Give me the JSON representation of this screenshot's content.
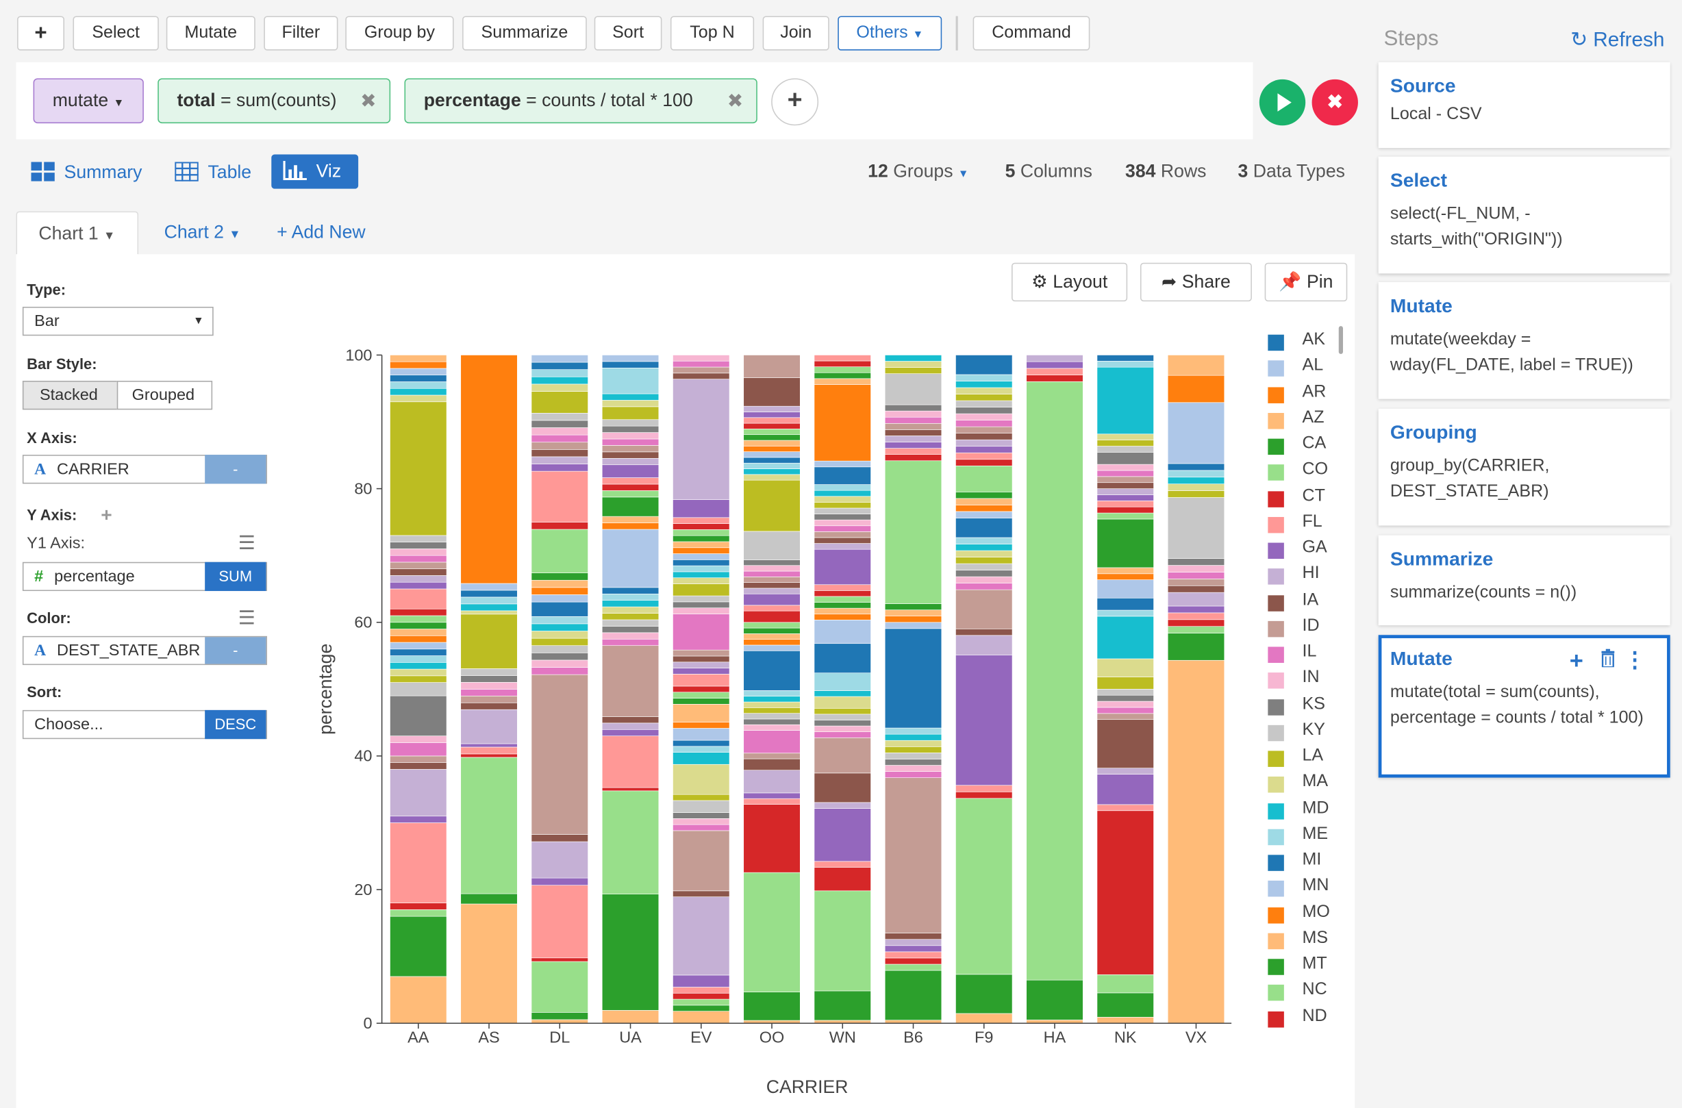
{
  "toolbar": {
    "add": "+",
    "items": [
      "Select",
      "Mutate",
      "Filter",
      "Group by",
      "Summarize",
      "Sort",
      "Top N",
      "Join"
    ],
    "others": "Others",
    "command": "Command"
  },
  "command": {
    "verb": "mutate",
    "exprs": [
      {
        "name": "total",
        "rest": " = sum(counts)"
      },
      {
        "name": "percentage",
        "rest": " = counts / total * 100"
      }
    ]
  },
  "views": {
    "summary": "Summary",
    "table": "Table",
    "viz": "Viz"
  },
  "stats": {
    "groups_n": "12",
    "groups_lbl": "Groups",
    "cols_n": "5",
    "cols_lbl": "Columns",
    "rows_n": "384",
    "rows_lbl": "Rows",
    "types_n": "3",
    "types_lbl": "Data Types"
  },
  "charts": {
    "chart1": "Chart 1",
    "chart2": "Chart 2",
    "add": "+ Add New"
  },
  "chart_buttons": {
    "layout": "Layout",
    "share": "Share",
    "pin": "Pin"
  },
  "config": {
    "type_label": "Type:",
    "type_value": "Bar",
    "barstyle_label": "Bar Style:",
    "stacked": "Stacked",
    "grouped": "Grouped",
    "x_label": "X Axis:",
    "x_value": "CARRIER",
    "x_tail": "-",
    "y_label": "Y Axis:",
    "y1_label": "Y1 Axis:",
    "y_value": "percentage",
    "y_tail": "SUM",
    "color_label": "Color:",
    "color_value": "DEST_STATE_ABR",
    "color_tail": "-",
    "sort_label": "Sort:",
    "sort_value": "Choose...",
    "sort_tail": "DESC"
  },
  "steps": {
    "title": "Steps",
    "refresh": "Refresh",
    "cards": [
      {
        "title": "Source",
        "detail": "Local - CSV"
      },
      {
        "title": "Select",
        "detail": "select(-FL_NUM, -starts_with(\"ORIGIN\"))"
      },
      {
        "title": "Mutate",
        "detail": "mutate(weekday = wday(FL_DATE, label = TRUE))"
      },
      {
        "title": "Grouping",
        "detail": "group_by(CARRIER, DEST_STATE_ABR)"
      },
      {
        "title": "Summarize",
        "detail": "summarize(counts = n())"
      },
      {
        "title": "Mutate",
        "detail": "mutate(total = sum(counts), percentage = counts / total * 100)"
      }
    ]
  },
  "chart_data": {
    "type": "bar",
    "stacked": true,
    "xlabel": "CARRIER",
    "ylabel": "percentage",
    "ylim": [
      0,
      100
    ],
    "yticks": [
      0,
      20,
      40,
      60,
      80,
      100
    ],
    "categories": [
      "AA",
      "AS",
      "DL",
      "UA",
      "EV",
      "OO",
      "WN",
      "B6",
      "F9",
      "HA",
      "NK",
      "VX"
    ],
    "legend": [
      {
        "name": "AK",
        "color": "#1f77b4"
      },
      {
        "name": "AL",
        "color": "#aec7e8"
      },
      {
        "name": "AR",
        "color": "#ff7f0e"
      },
      {
        "name": "AZ",
        "color": "#ffbb78"
      },
      {
        "name": "CA",
        "color": "#2ca02c"
      },
      {
        "name": "CO",
        "color": "#98df8a"
      },
      {
        "name": "CT",
        "color": "#d62728"
      },
      {
        "name": "FL",
        "color": "#ff9896"
      },
      {
        "name": "GA",
        "color": "#9467bd"
      },
      {
        "name": "HI",
        "color": "#c5b0d5"
      },
      {
        "name": "IA",
        "color": "#8c564b"
      },
      {
        "name": "ID",
        "color": "#c49c94"
      },
      {
        "name": "IL",
        "color": "#e377c2"
      },
      {
        "name": "IN",
        "color": "#f7b6d2"
      },
      {
        "name": "KS",
        "color": "#7f7f7f"
      },
      {
        "name": "KY",
        "color": "#c7c7c7"
      },
      {
        "name": "LA",
        "color": "#bcbd22"
      },
      {
        "name": "MA",
        "color": "#dbdb8d"
      },
      {
        "name": "MD",
        "color": "#17becf"
      },
      {
        "name": "ME",
        "color": "#9edae5"
      },
      {
        "name": "MI",
        "color": "#1f77b4"
      },
      {
        "name": "MN",
        "color": "#aec7e8"
      },
      {
        "name": "MO",
        "color": "#ff7f0e"
      },
      {
        "name": "MS",
        "color": "#ffbb78"
      },
      {
        "name": "MT",
        "color": "#2ca02c"
      },
      {
        "name": "NC",
        "color": "#98df8a"
      },
      {
        "name": "ND",
        "color": "#d62728"
      }
    ],
    "palette": [
      "#ffbb78",
      "#2ca02c",
      "#98df8a",
      "#d62728",
      "#ff9896",
      "#9467bd",
      "#c5b0d5",
      "#8c564b",
      "#c49c94",
      "#e377c2",
      "#f7b6d2",
      "#7f7f7f",
      "#c7c7c7",
      "#bcbd22",
      "#dbdb8d",
      "#17becf",
      "#9edae5",
      "#1f77b4",
      "#aec7e8",
      "#ff7f0e"
    ],
    "stacks": [
      [
        7,
        9,
        1,
        1,
        12,
        1,
        7,
        1,
        1,
        2,
        1,
        6,
        2,
        1,
        1,
        1,
        1,
        1,
        1,
        1,
        1,
        1,
        1,
        1,
        3,
        1,
        1,
        1,
        1,
        1,
        1,
        1,
        1,
        20,
        1,
        1,
        1,
        1,
        1,
        1,
        1
      ],
      [
        17.5,
        1.5,
        20,
        0.5,
        1,
        0.5,
        5,
        1,
        1,
        1,
        1,
        1,
        1,
        8,
        0.5,
        1,
        1,
        1,
        1,
        33.5
      ],
      [
        0.5,
        1,
        7,
        0.5,
        10,
        1,
        5,
        1,
        22,
        1,
        1,
        1,
        1,
        1,
        1,
        1,
        1,
        2,
        1,
        1,
        1,
        1,
        6,
        1,
        7,
        1,
        1,
        1,
        1,
        1,
        1,
        1,
        1,
        3,
        1,
        1,
        1,
        1,
        1
      ],
      [
        2,
        18,
        16,
        0.5,
        8,
        1,
        1,
        1,
        11,
        1,
        1,
        1,
        1,
        1,
        1,
        1,
        1,
        1,
        9,
        1,
        1,
        3,
        1,
        1,
        1,
        2,
        1,
        1,
        1,
        1,
        1,
        1,
        1,
        2,
        1,
        1,
        4,
        1,
        1
      ],
      [
        2,
        1,
        1,
        1,
        1,
        2,
        13,
        1,
        10,
        1,
        1,
        1,
        2,
        1,
        5,
        2,
        1,
        1,
        2,
        1,
        3,
        1,
        1,
        1,
        2,
        1,
        1,
        1,
        1,
        6,
        1,
        1,
        1,
        2,
        1,
        1,
        1,
        1,
        1,
        1,
        1,
        1,
        1,
        1,
        1,
        3,
        20,
        1,
        1,
        1,
        1
      ],
      [
        0.5,
        5,
        21,
        12,
        1,
        1,
        4,
        2,
        1,
        4,
        1,
        1,
        1,
        1,
        1,
        1,
        1,
        7,
        1,
        1,
        1,
        1,
        1,
        2,
        1,
        2,
        1,
        1,
        1,
        1,
        1,
        1,
        5,
        9,
        1,
        1,
        1,
        1,
        1,
        1,
        1,
        1,
        1,
        1,
        1,
        1,
        1,
        5,
        4
      ],
      [
        0.5,
        5,
        17,
        4,
        1,
        9,
        1,
        5,
        6,
        1,
        1,
        1,
        1,
        1,
        2,
        1,
        3,
        5,
        4,
        1,
        1,
        1,
        1,
        1,
        1,
        6,
        1,
        1,
        1,
        1,
        1,
        1,
        1,
        1,
        1,
        1,
        1,
        3,
        1,
        13,
        1,
        1,
        1,
        1,
        1
      ],
      [
        0.5,
        8,
        1,
        1,
        1,
        1,
        1,
        1,
        25,
        1,
        1,
        1,
        1,
        1,
        1,
        1,
        1,
        16,
        1,
        1,
        1,
        1,
        23,
        1,
        1,
        1,
        1,
        1,
        1,
        1,
        1,
        1,
        5,
        1,
        1,
        1
      ],
      [
        1.5,
        6,
        27,
        1,
        1,
        20,
        3,
        1,
        6,
        1,
        1,
        1,
        1,
        1,
        1,
        1,
        1,
        3,
        1,
        1,
        1,
        1,
        4,
        1,
        1,
        1,
        1,
        1,
        1,
        1,
        1,
        1,
        1,
        1,
        1,
        1,
        1,
        3
      ],
      [
        0.5,
        6,
        90,
        1,
        1,
        1,
        1
      ],
      [
        1,
        4,
        3,
        27,
        1,
        5,
        1,
        8,
        1,
        1,
        1,
        1,
        1,
        2,
        3,
        7,
        1,
        2,
        3,
        1,
        1,
        8,
        1,
        1,
        1,
        1,
        1,
        1,
        1,
        1,
        1,
        2,
        1,
        1,
        1,
        11,
        1,
        1
      ],
      [
        53.5,
        4,
        1,
        1,
        1,
        1,
        2,
        1,
        1,
        1,
        1,
        1,
        9,
        1,
        1,
        1,
        1,
        1,
        9,
        4,
        3
      ]
    ]
  }
}
